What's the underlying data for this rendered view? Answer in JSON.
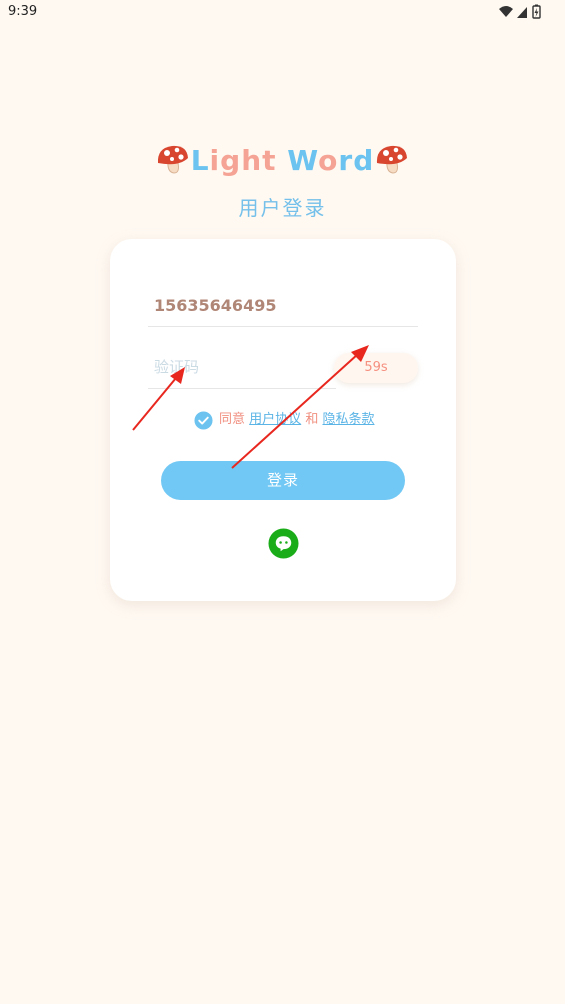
{
  "status_bar": {
    "time": "9:39"
  },
  "brand": {
    "letters": [
      "L",
      "i",
      "g",
      "h",
      "t",
      " ",
      "W",
      "o",
      "r",
      "d"
    ],
    "blue": "#6cc3ef",
    "pink": "#f5a394"
  },
  "subtitle": "用户登录",
  "form": {
    "phone_value": "15635646495",
    "code_placeholder": "验证码",
    "countdown_label": "59s",
    "agree_prefix": "同意",
    "user_agreement": "用户协议",
    "agree_and": "和",
    "privacy_policy": "隐私条款",
    "checkbox_checked": true,
    "login_label": "登录"
  },
  "icons": {
    "mushroom_left": "mushroom-icon",
    "mushroom_right": "mushroom-icon",
    "check": "check-circle-icon",
    "wechat": "wechat-icon"
  },
  "colors": {
    "background": "#fff9f2",
    "accent_blue": "#72c8f4",
    "accent_pink": "#f08f80",
    "wechat_green": "#1aad19",
    "annotation_red": "#e8271f"
  }
}
